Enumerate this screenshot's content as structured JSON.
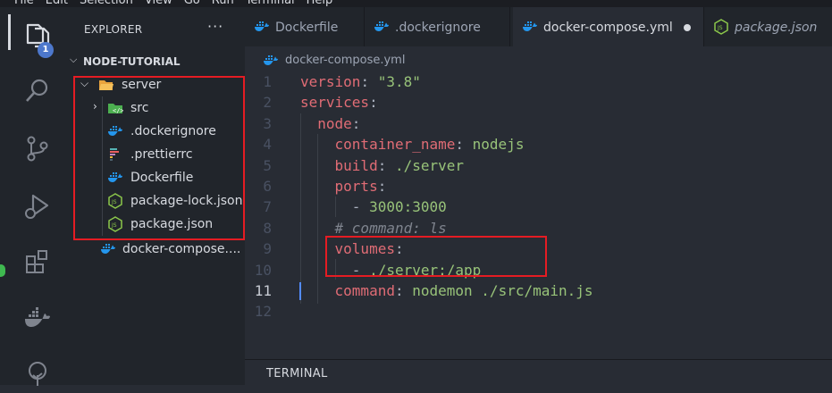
{
  "menubar": [
    "File",
    "Edit",
    "Selection",
    "View",
    "Go",
    "Run",
    "Terminal",
    "Help"
  ],
  "activity": {
    "items": [
      "files-icon",
      "search-icon",
      "source-control-icon",
      "run-debug-icon",
      "extensions-icon",
      "docker-icon",
      "tree-icon"
    ],
    "badge": "1"
  },
  "sidebar": {
    "title": "EXPLORER",
    "more": "···",
    "project": "NODE-TUTORIAL",
    "tree": [
      {
        "label": "server",
        "icon": "folder-open-icon"
      },
      {
        "label": "src",
        "icon": "src-folder-icon"
      },
      {
        "label": ".dockerignore",
        "icon": "docker-icon"
      },
      {
        "label": ".prettierrc",
        "icon": "prettier-icon"
      },
      {
        "label": "Dockerfile",
        "icon": "docker-icon"
      },
      {
        "label": "package-lock.json",
        "icon": "nodejs-icon"
      },
      {
        "label": "package.json",
        "icon": "nodejs-icon"
      },
      {
        "label": "docker-compose....",
        "icon": "docker-icon"
      }
    ]
  },
  "tabs": [
    {
      "label": "Dockerfile",
      "icon": "docker-icon"
    },
    {
      "label": ".dockerignore",
      "icon": "docker-icon"
    },
    {
      "label": "docker-compose.yml",
      "icon": "docker-icon",
      "active": true,
      "modified": true
    },
    {
      "label": "package.json",
      "icon": "nodejs-icon"
    }
  ],
  "breadcrumb": "docker-compose.yml",
  "editor": {
    "line_numbers": [
      "1",
      "2",
      "3",
      "4",
      "5",
      "6",
      "7",
      "8",
      "9",
      "10",
      "11",
      "12"
    ],
    "current_line": "11",
    "lines": [
      [
        {
          "t": "version",
          "c": "k"
        },
        {
          "t": ": ",
          "c": "p"
        },
        {
          "t": "\"3.8\"",
          "c": "s"
        }
      ],
      [
        {
          "t": "services",
          "c": "k"
        },
        {
          "t": ":",
          "c": "p"
        }
      ],
      [
        {
          "t": "  ",
          "c": "ws"
        },
        {
          "t": "node",
          "c": "k"
        },
        {
          "t": ":",
          "c": "p"
        }
      ],
      [
        {
          "t": "    ",
          "c": "ws"
        },
        {
          "t": "container_name",
          "c": "k"
        },
        {
          "t": ": ",
          "c": "p"
        },
        {
          "t": "nodejs",
          "c": "s"
        }
      ],
      [
        {
          "t": "    ",
          "c": "ws"
        },
        {
          "t": "build",
          "c": "k"
        },
        {
          "t": ": ",
          "c": "p"
        },
        {
          "t": "./server",
          "c": "s"
        }
      ],
      [
        {
          "t": "    ",
          "c": "ws"
        },
        {
          "t": "ports",
          "c": "k"
        },
        {
          "t": ":",
          "c": "p"
        }
      ],
      [
        {
          "t": "      ",
          "c": "ws"
        },
        {
          "t": "- ",
          "c": "p"
        },
        {
          "t": "3000:3000",
          "c": "s"
        }
      ],
      [
        {
          "t": "    ",
          "c": "ws"
        },
        {
          "t": "# command: ls",
          "c": "c"
        }
      ],
      [
        {
          "t": "    ",
          "c": "ws"
        },
        {
          "t": "volumes",
          "c": "k"
        },
        {
          "t": ":",
          "c": "p"
        }
      ],
      [
        {
          "t": "      ",
          "c": "ws"
        },
        {
          "t": "- ",
          "c": "p"
        },
        {
          "t": "./server:/app",
          "c": "s"
        }
      ],
      [
        {
          "t": "    ",
          "c": "ws"
        },
        {
          "t": "command",
          "c": "k"
        },
        {
          "t": ": ",
          "c": "p"
        },
        {
          "t": "nodemon ./src/main.js",
          "c": "s"
        }
      ],
      []
    ]
  },
  "panel": {
    "terminal": "TERMINAL"
  },
  "colors": {
    "highlight_box": "#e51c23",
    "badge": "#4d78cc",
    "modified_dot": "#d7dae0"
  }
}
